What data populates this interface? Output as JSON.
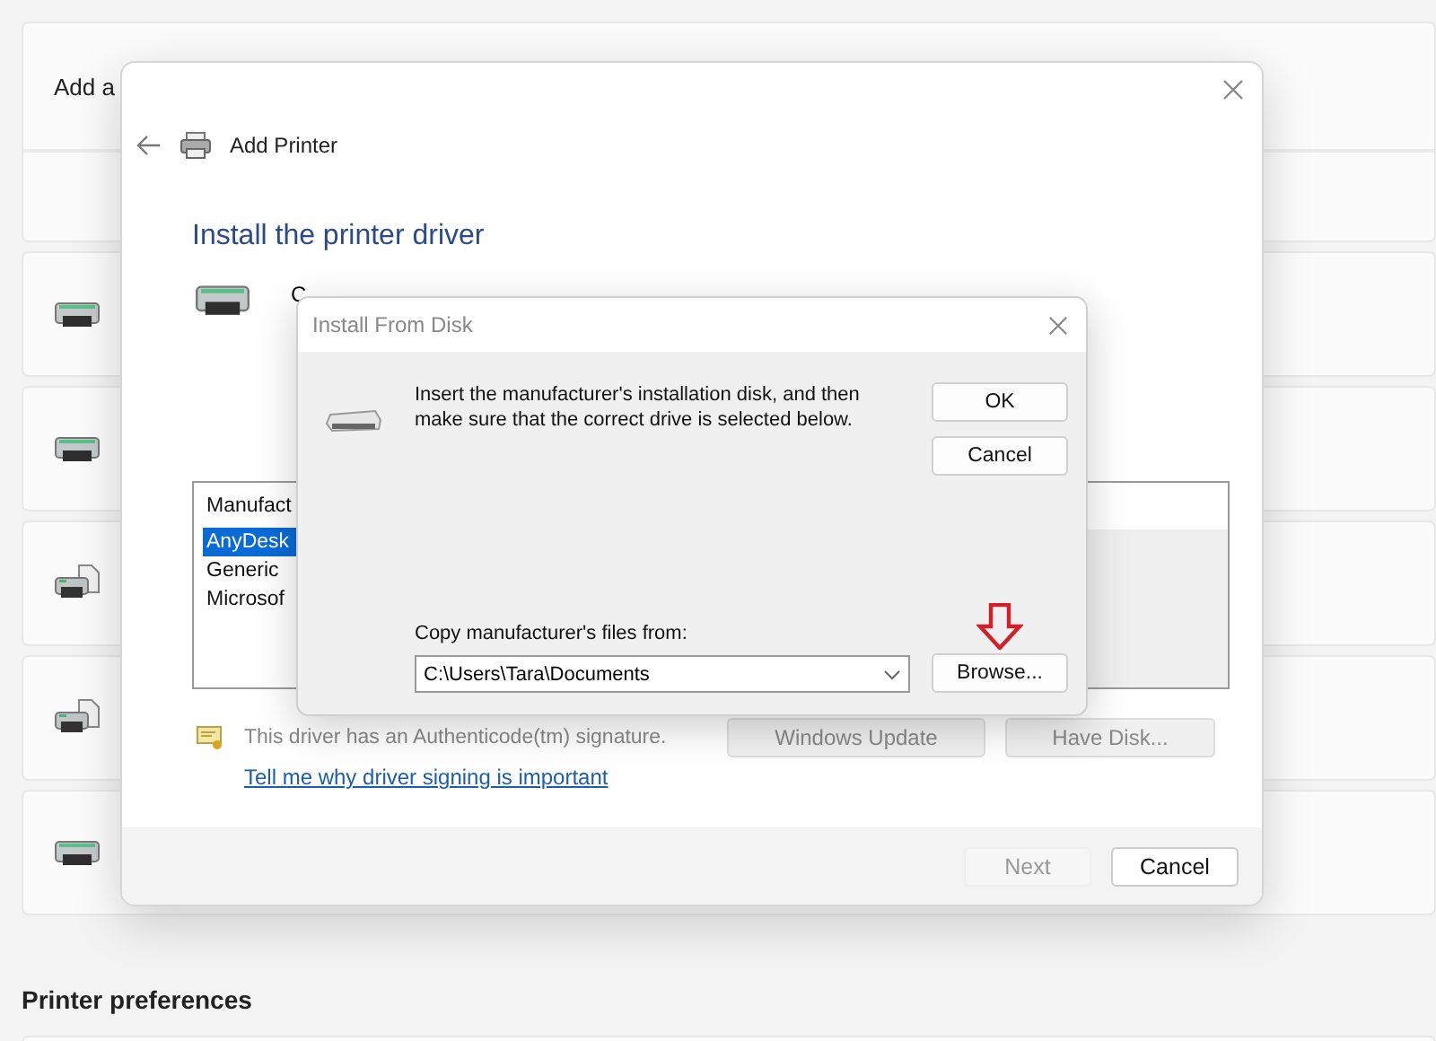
{
  "settings": {
    "add_label": "Add a",
    "devices": [
      {
        "kind": "printer"
      },
      {
        "kind": "printer"
      },
      {
        "kind": "fax"
      },
      {
        "kind": "fax"
      },
      {
        "kind": "printer"
      }
    ],
    "section_title": "Printer preferences"
  },
  "wizard": {
    "title": "Add Printer",
    "heading": "Install the printer driver",
    "hidden_text": [
      "C"
    ],
    "list": {
      "header": "Manufact",
      "items": [
        {
          "label": "AnyDesk",
          "selected": true
        },
        {
          "label": "Generic",
          "selected": false
        },
        {
          "label": "Microsof",
          "selected": false
        }
      ]
    },
    "signature_text": "This driver has an Authenticode(tm) signature.",
    "buttons": [
      {
        "label": "Windows Update",
        "disabled": true
      },
      {
        "label": "Have Disk...",
        "disabled": true
      }
    ],
    "link": "Tell me why driver signing is important",
    "footer_buttons": [
      {
        "label": "Next",
        "disabled": true
      },
      {
        "label": "Cancel",
        "disabled": false
      }
    ]
  },
  "dialog": {
    "title": "Install From Disk",
    "message": "Insert the manufacturer's installation disk, and then make sure that the correct drive is selected below.",
    "ok": "OK",
    "cancel": "Cancel",
    "copy_label": "Copy manufacturer's files from:",
    "path": "C:\\Users\\Tara\\Documents",
    "browse": "Browse..."
  }
}
